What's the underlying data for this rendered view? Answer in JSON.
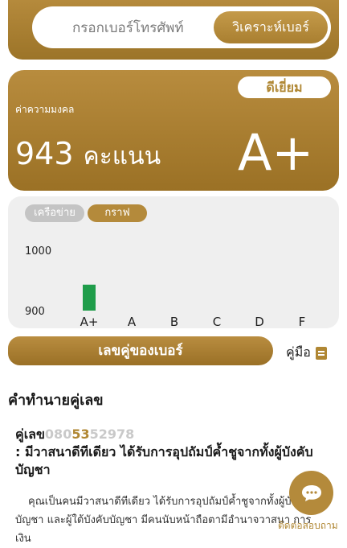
{
  "search": {
    "placeholder": "กรอกเบอร์โทรศัพท์",
    "button_label": "วิเคราะห์เบอร์"
  },
  "score_card": {
    "badge": "ดีเยี่ยม",
    "label": "ค่าความมงคล",
    "score": "943",
    "score_unit": "คะแนน",
    "grade": "A+"
  },
  "chart_tabs": {
    "network": "เครือข่าย",
    "graph": "กราฟ"
  },
  "chart_data": {
    "type": "bar",
    "categories": [
      "A+",
      "A",
      "B",
      "C",
      "D",
      "F"
    ],
    "values": [
      943,
      null,
      null,
      null,
      null,
      null
    ],
    "title": "",
    "xlabel": "",
    "ylabel": "",
    "ylim": [
      900,
      1000
    ],
    "yticks": [
      "1000",
      "900"
    ],
    "bar_color": "#1f9d4a",
    "grid": false
  },
  "section": {
    "title": "เลขคู่ของเบอร์",
    "manual_label": "คู่มือ"
  },
  "prediction": {
    "title": "คำทำนายคู่เลข",
    "pair_prefix": "คู่เลข",
    "phone_before": "080",
    "phone_highlight": "53",
    "phone_after": "52978",
    "meaning": ": มีวาสนาดีทีเดียว ได้รับการอุปถัมป์ค้ำชูจากทั้งผู้บังคับบัญชา",
    "description": "คุณเป็นคนมีวาสนาดีทีเดียว ได้รับการอุปถัมป์ค้ำชูจากทั้งผู้บังคับบัญชา และผู้ใต้บังคับบัญชา มีคนนับหน้าถือตามีอำนาจวาสนา การเงิน"
  },
  "chat": {
    "label": "ติดต่อสอบถาม",
    "icon": "chat-bubble-icon"
  },
  "colors": {
    "gold": "#b08733",
    "bar_green": "#1f9d4a",
    "panel_gray": "#efefef"
  }
}
